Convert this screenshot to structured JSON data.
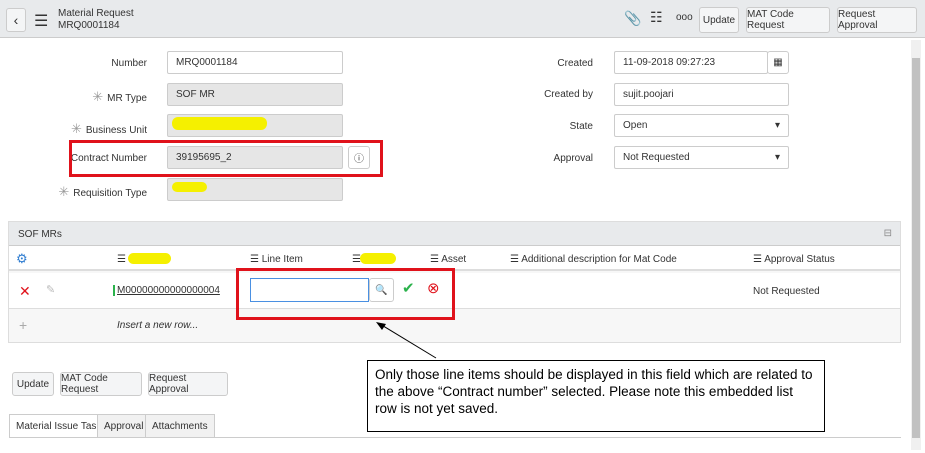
{
  "header": {
    "title": "Material Request",
    "subtitle": "MRQ0001184",
    "buttons": [
      "Update",
      "MAT Code Request",
      "Request Approval"
    ]
  },
  "form": {
    "number": {
      "label": "Number",
      "value": "MRQ0001184"
    },
    "mr_type": {
      "label": "MR Type",
      "value": "SOF MR"
    },
    "business_unit": {
      "label": "Business Unit",
      "value": ""
    },
    "contract_number": {
      "label": "Contract Number",
      "value": "39195695_2"
    },
    "requisition_type": {
      "label": "Requisition Type",
      "value": ""
    },
    "created": {
      "label": "Created",
      "value": "11-09-2018 09:27:23"
    },
    "created_by": {
      "label": "Created by",
      "value": "sujit.poojari"
    },
    "state": {
      "label": "State",
      "value": "Open"
    },
    "approval": {
      "label": "Approval",
      "value": "Not Requested"
    }
  },
  "list": {
    "title": "SOF MRs",
    "columns": [
      "",
      "Line Item",
      "",
      "Asset",
      "Additional description for Mat Code",
      "Approval Status"
    ],
    "row": {
      "id": "M00000000000000004",
      "line_item": "",
      "approval_status": "Not Requested"
    },
    "insert": "Insert a new row..."
  },
  "bottom_buttons": [
    "Update",
    "MAT Code Request",
    "Request Approval"
  ],
  "tabs": [
    "Material Issue Tasks",
    "Approval",
    "Attachments"
  ],
  "annotation": "Only those line items should be displayed in this field which are related to the above “Contract number” selected. Please note this embedded list row is not yet saved.",
  "colors": {
    "highlight": "#e0121b",
    "redaction": "#f5f000"
  }
}
